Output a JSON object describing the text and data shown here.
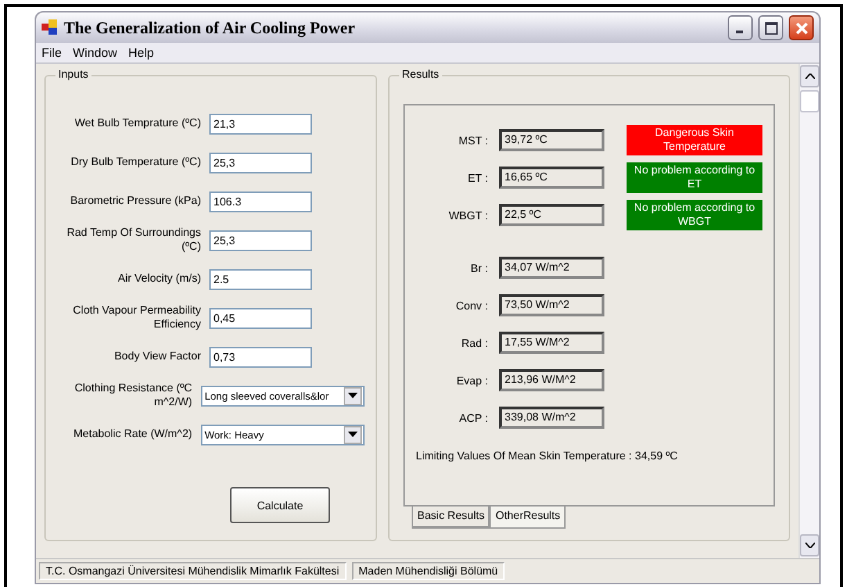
{
  "window": {
    "title": "The Generalization of Air Cooling Power"
  },
  "menu": [
    "File",
    "Window",
    "Help"
  ],
  "inputs": {
    "title": "Inputs",
    "fields": [
      {
        "kind": "text",
        "label": "Wet Bulb Temprature (ºC)",
        "value": "21,3"
      },
      {
        "kind": "text",
        "label": "Dry Bulb Temperature (ºC)",
        "value": "25,3"
      },
      {
        "kind": "text",
        "label": "Barometric Pressure (kPa)",
        "value": "106.3"
      },
      {
        "kind": "text",
        "label": "Rad Temp Of Surroundings (ºC)",
        "value": "25,3"
      },
      {
        "kind": "text",
        "label": "Air Velocity (m/s)",
        "value": "2.5"
      },
      {
        "kind": "text",
        "label": "Cloth Vapour Permeability Efficiency",
        "value": "0,45"
      },
      {
        "kind": "text",
        "label": "Body View Factor",
        "value": "0,73"
      },
      {
        "kind": "select",
        "label": "Clothing Resistance (ºC m^2/W)",
        "value": "Long sleeved coveralls&lor"
      },
      {
        "kind": "select",
        "label": "Metabolic Rate (W/m^2)",
        "value": "Work: Heavy"
      }
    ],
    "button": "Calculate"
  },
  "results": {
    "title": "Results",
    "rows": [
      {
        "label": "MST :",
        "value": "39,72 ºC",
        "status": {
          "text": "Dangerous Skin Temperature",
          "color": "#ff0000"
        }
      },
      {
        "label": "ET :",
        "value": "16,65 ºC",
        "status": {
          "text": "No problem according to ET",
          "color": "#008000"
        }
      },
      {
        "label": "WBGT :",
        "value": "22,5 ºC",
        "status": {
          "text": "No problem according to WBGT",
          "color": "#008000"
        }
      },
      {
        "label": "Br :",
        "value": "34,07 W/m^2"
      },
      {
        "label": "Conv :",
        "value": "73,50 W/m^2"
      },
      {
        "label": "Rad :",
        "value": "17,55 W/M^2"
      },
      {
        "label": "Evap :",
        "value": "213,96 W/M^2"
      },
      {
        "label": "ACP :",
        "value": "339,08 W/m^2"
      }
    ],
    "limit": "Limiting Values Of Mean Skin Temperature : 34,59 ºC",
    "tabs": [
      {
        "label": "Basic Results",
        "selected": true
      },
      {
        "label": "OtherResults",
        "selected": false
      }
    ]
  },
  "status_bar": [
    "T.C. Osmangazi Üniversitesi Mühendislik Mimarlık Fakültesi",
    "Maden Mühendisliği Bölümü"
  ]
}
